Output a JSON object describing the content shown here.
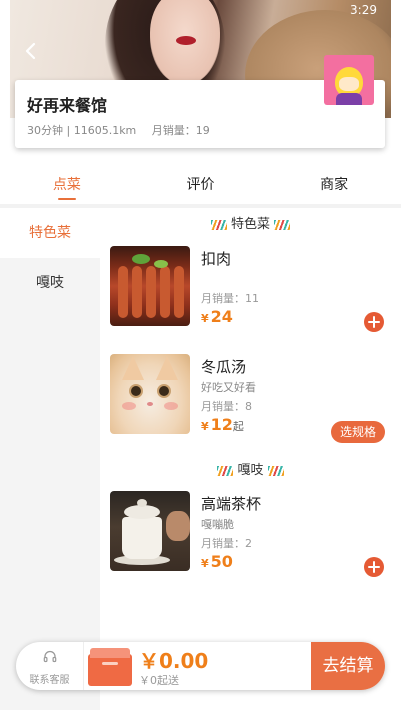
{
  "status": {
    "time": "3:29"
  },
  "shop": {
    "name": "好再来餐馆",
    "delivery_time": "30分钟",
    "distance": "11605.1km",
    "sales": "月销量：19"
  },
  "tabs": [
    {
      "label": "点菜",
      "active": true
    },
    {
      "label": "评价",
      "active": false
    },
    {
      "label": "商家",
      "active": false
    }
  ],
  "categories": [
    {
      "label": "特色菜",
      "active": true
    },
    {
      "label": "嘎吱",
      "active": false
    }
  ],
  "sections": [
    {
      "title": "特色菜",
      "items": [
        {
          "name": "扣肉",
          "desc": "",
          "sales": "月销量：11",
          "currency": "¥",
          "price": "24",
          "suffix": "",
          "action": "add"
        },
        {
          "name": "冬瓜汤",
          "desc": "好吃又好看",
          "sales": "月销量：8",
          "currency": "¥",
          "price": "12",
          "suffix": "起",
          "action": "选规格"
        }
      ]
    },
    {
      "title": "嘎吱",
      "items": [
        {
          "name": "高端茶杯",
          "desc": "嘎嘣脆",
          "sales": "月销量：2",
          "currency": "¥",
          "price": "50",
          "suffix": "",
          "action": "add"
        }
      ]
    }
  ],
  "cart": {
    "service_label": "联系客服",
    "total": "￥0.00",
    "min_delivery": "￥0起送",
    "checkout_label": "去结算"
  },
  "colors": {
    "accent": "#e8703a",
    "price": "#ef7f1a",
    "button": "#e55a34"
  }
}
